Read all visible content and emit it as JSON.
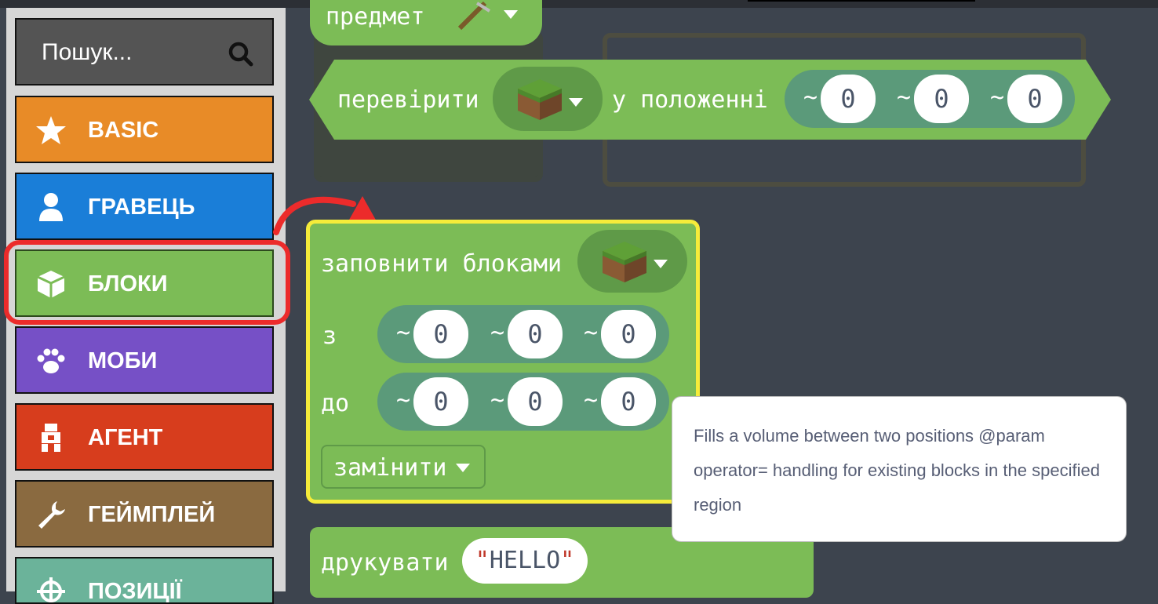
{
  "search": {
    "placeholder": "Пошук...",
    "icon": "search-icon"
  },
  "categories": [
    {
      "label": "BASIC",
      "icon": "star-icon",
      "color": "#e88b27"
    },
    {
      "label": "ГРАВЕЦЬ",
      "icon": "person-icon",
      "color": "#1a7ed8"
    },
    {
      "label": "БЛОКИ",
      "icon": "cube-icon",
      "color": "#7cbc56"
    },
    {
      "label": "МОБИ",
      "icon": "paw-icon",
      "color": "#7650c6"
    },
    {
      "label": "АГЕНТ",
      "icon": "agent-icon",
      "color": "#d73d1d"
    },
    {
      "label": "ГЕЙМПЛЕЙ",
      "icon": "wrench-icon",
      "color": "#8a6a40"
    },
    {
      "label": "ПОЗИЦІЇ",
      "icon": "crosshair-icon",
      "color": "#6bb39a"
    }
  ],
  "selected_category": "БЛОКИ",
  "workspace": {
    "item_block": {
      "label": "предмет"
    },
    "test_block": {
      "label": "перевірити",
      "position_label": "у положенні",
      "x": "0",
      "y": "0",
      "z": "0",
      "tilde": "~"
    },
    "fill_block": {
      "label": "заповнити блоками",
      "from_label": "з",
      "to_label": "до",
      "from": [
        "0",
        "0",
        "0"
      ],
      "to": [
        "0",
        "0",
        "0"
      ],
      "tilde": "~",
      "operator": "замінити"
    },
    "print_block": {
      "label": "друкувати",
      "text": "HELLO",
      "quote": "\""
    }
  },
  "tooltip": {
    "text": "Fills a volume between two positions @param operator= handling for existing blocks in the specified region"
  },
  "accent": {
    "selection_ring": "#ec2b2b",
    "block_highlight": "#f6ec3a"
  }
}
